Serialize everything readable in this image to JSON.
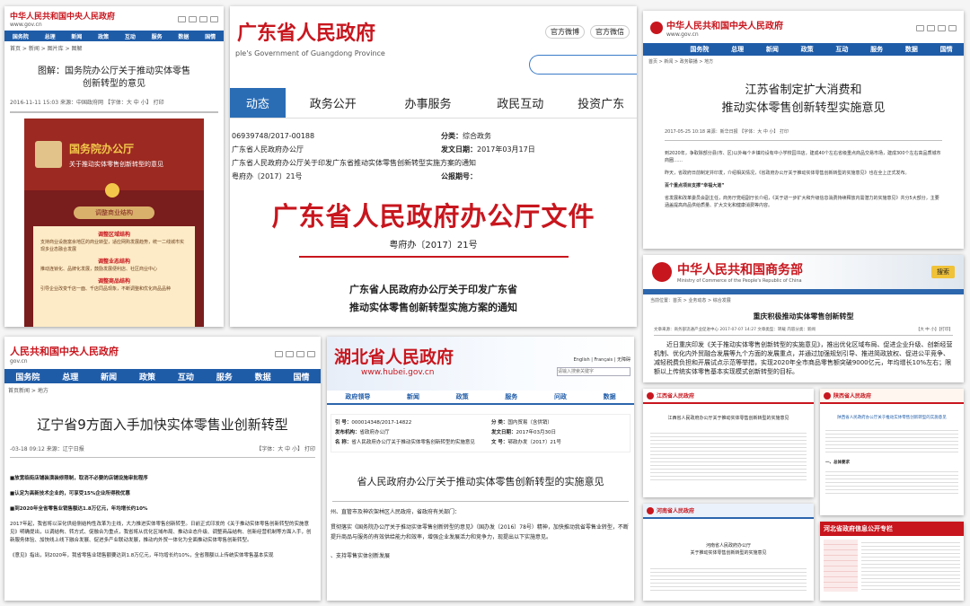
{
  "c1": {
    "title": "中华人民共和国中央人民政府",
    "url": "www.gov.cn",
    "nav": [
      "国务院",
      "总理",
      "新闻",
      "政策",
      "互动",
      "服务",
      "数据",
      "国情"
    ],
    "breadcrumb": "首页 > 新闻 > 图片库 > 图解",
    "headline1": "图解：国务院办公厅关于推动实体零售",
    "headline2": "创新转型的意见",
    "meta": "2016-11-11 15:03  来源：中国政府网  【字体：大 中 小】 打印",
    "poster_title1": "国务院办公厅",
    "poster_title2": "关于推动实体零售创新转型的意见",
    "poster_badge": "调整商业结构",
    "sec1": "调整区域结构",
    "sec1_text": "支持商业设施富余地区的商业转型，适应网购发展趋势，统一二线城市实现多业态融合发展",
    "sec2": "调整业态结构",
    "sec2_text": "推动连锁化、品牌化发展，鼓励发展便利店、社区商业中心",
    "sec3": "调整商品结构",
    "sec3_text": "引导企业改变千店一面、千店同品现象，不断调整和优化商品品种"
  },
  "c2": {
    "title": "广东省人民政府",
    "subtitle": "ple's Government of Guangdong Province",
    "weibo1": "官方微博",
    "weibo2": "官方微信",
    "nav": [
      "动态",
      "政务公开",
      "办事服务",
      "政民互动",
      "投资广东"
    ],
    "doc_index": "06939748/2017-00188",
    "classify_label": "分类：",
    "classify": "综合政务",
    "issuer": "广东省人民政府办公厅",
    "date_label": "发文日期：",
    "date": "2017年03月17日",
    "doc_title": "广东省人民政府办公厅关于印发广东省推动实体零售创新转型实施方案的通知",
    "doc_no": "粤府办〔2017〕21号",
    "pub_label": "公报期号：",
    "banner": "广东省人民政府办公厅文件",
    "banner_no": "粤府办〔2017〕21号",
    "notice1": "广东省人民政府办公厅关于印发广东省",
    "notice2": "推动实体零售创新转型实施方案的通知"
  },
  "c3": {
    "title": "中华人民共和国中央人民政府",
    "url": "www.gov.cn",
    "nav": [
      "国务院",
      "总理",
      "新闻",
      "政策",
      "互动",
      "服务",
      "数据",
      "国情"
    ],
    "breadcrumb": "首页 > 新闻 > 政务联播 > 地方",
    "headline1": "江苏省制定扩大消费和",
    "headline2": "推动实体零售创新转型实施意见",
    "meta": "2017-05-25 10:18  来源：新华日报  【字体：大 中 小】 打印",
    "para1": "到2020年，争取除部分县(市、区)以外每个乡镇均设有中小学校园书店，建成40个左右省级重点商品交易市场，建成300个左右高品质城市商圈……",
    "para2": "昨天，省政府日前制定并印发，介绍相关情况，《省政府办公厅关于推动实体零售创新转型的实施意见》也在全上正式发布。",
    "para3": "百个重点项目支撑“幸福大道”",
    "para4": "省发展和改革委员会副主任，商务厅党组副厅长介绍，《关于进一步扩大和升级信息消费持续释放内需潜力的实施意见》共分5大部分，主要涵盖提高商品供给质量、扩大文化和健康消费等内容。"
  },
  "c4": {
    "title": "中华人民共和国商务部",
    "subtitle": "Ministry of Commerce of the People's Republic of China",
    "search": "搜索",
    "breadcrumb": "当前位置：首页 > 业务动态 > 综合发展",
    "headline": "重庆积极推动实体零售创新转型",
    "meta": "文章来源：商务部流通产业促进中心  2017-07-07 14:27  文章类型：转载  内容分类：新闻",
    "font": "【大 中 小】【打印】",
    "body": "近日重庆印发《关于推动实体零售创新转型的实施意见》，推出优化区域布局、促进企业升级、创新经营机制、优化内外贸融合发展等九个方面的发展重点，并通过加强规划引导、推进简政放权、促进公平竞争、减轻税费负担和开展试点示范等举措，实现2020年全市商品零售额突破9000亿元，年均增长10%左右；限额以上传统实体零售基本实现模式创新转型的目标。"
  },
  "c5": {
    "title": "人民共和国中央人民政府",
    "url": "gov.cn",
    "nav": [
      "国务院",
      "总理",
      "新闻",
      "政策",
      "互动",
      "服务",
      "数据",
      "国情"
    ],
    "breadcrumb": "首页新闻 > 地方",
    "headline": "辽宁省9方面入手加快实体零售业创新转型",
    "meta": "-03-18 09:12  来源：辽宁日报",
    "font": "【字体：大 中 小】 打印",
    "b1": "■放宽临街店铺装潢装修限制，取消不必要的店铺设施审批程序",
    "b2": "■认定为高新技术企业的，可享受15%企业所得税优惠",
    "b3": "■到2020年全省零售业销售额达1.8万亿元，年均增长约10%",
    "para1": "2017年起，我省将以深化供给侧结构性改革为主线，大力推进实体零售创新转型。日前正式印发的《关于推动实体零售创新转型的实施意见》明确提出，以调结构、转方式、促融合为重点，我省将从优化区域布局、推动业态升级、调整商品结构、创新经营机制等方面入手，创新服务体验、加快线上线下融合发展、促进多产业联动发展，推动内外贸一体化为全面推动实体零售创新转型。",
    "para2": "《意见》指出，到2020年，我省零售业销售额要达到1.8万亿元，年均增长约10%，全省限额以上传统实体零售基本实现"
  },
  "c6": {
    "title": "湖北省人民政府",
    "url": "www.hubei.gov.cn",
    "langs": "English | Français | 无障碍",
    "search_placeholder": "请输入搜索关键字",
    "nav": [
      "政府领导",
      "新闻",
      "政策",
      "服务",
      "问政",
      "数据"
    ],
    "index_label": "引 号：",
    "index": "000014348/2017-14822",
    "class_label": "分 类：",
    "class": "国内贸易（含供销）",
    "org_label": "发布机构：",
    "org": "省政府办公厅",
    "date_label": "发文日期：",
    "date": "2017年03月30日",
    "name_label": "名 称：",
    "name": "省人民政府办公厅关于推动实体零售创新转型的实施意见",
    "no_label": "文 号：",
    "no": "鄂政办发〔2017〕21号",
    "doc_title": "省人民政府办公厅关于推动实体零售创新转型的实施意见",
    "body1": "州、直管市及神农架林区人民政府，省政府有关部门：",
    "body2": "贯彻落实《国务院办公厅关于推动实体零售创新转型的意见》（国办发〔2016〕78号）精神，加快推动我省零售业转型，不断提升商品与服务的有效供给能力和效率，增强企业发展活力和竞争力，现提出以下实施意见。",
    "body3": "、支持零售实体创新发展"
  },
  "c7": {
    "title": "江西省人民政府",
    "headline": "江西省人民政府办公厅关于推动实体零售创新转型的实施意见"
  },
  "c8": {
    "title": "陕西省人民政府",
    "headline": "陕西省人民政府办公厅关于推动实体零售创新转型的实施意见",
    "sub": "一、总体要求"
  },
  "c9": {
    "title": "河南省人民政府",
    "headline1": "河南省人民政府办公厅",
    "headline2": "关于推动实体零售创新转型的实施意见"
  },
  "c10": {
    "title": "河北省政府信息公开专栏"
  }
}
